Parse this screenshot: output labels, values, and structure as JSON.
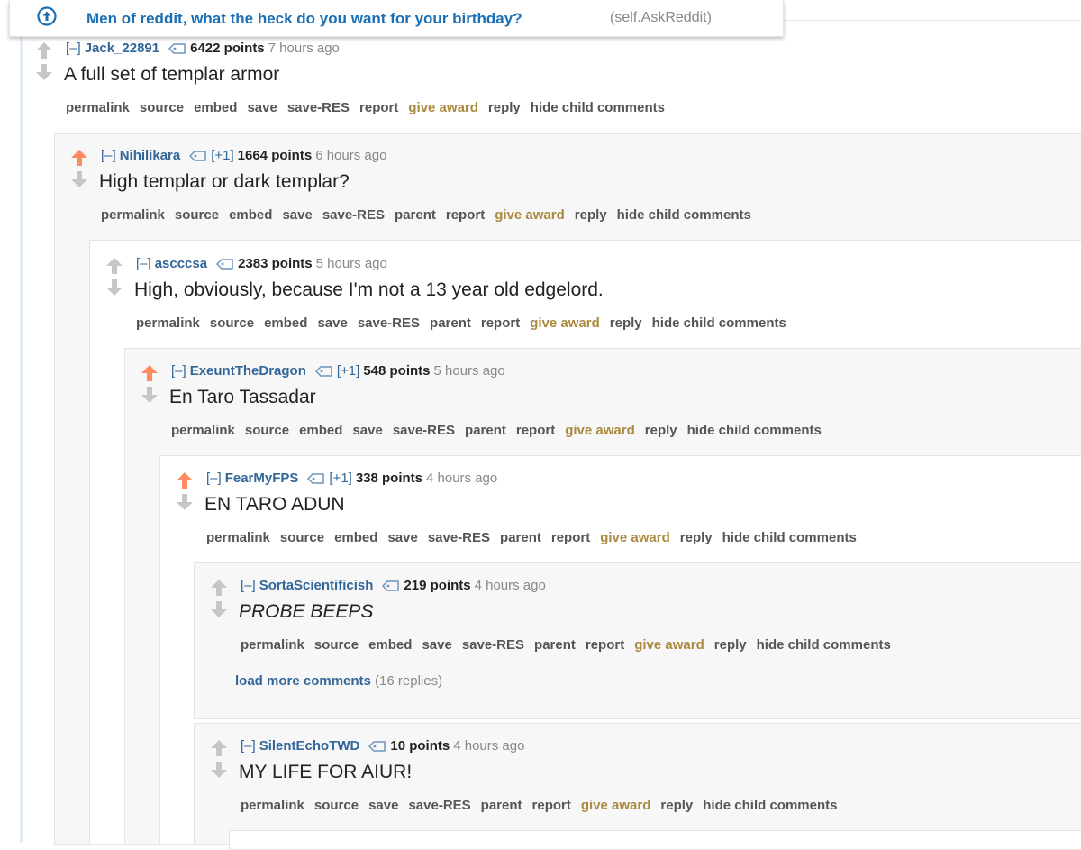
{
  "header": {
    "title": "Men of reddit, what the heck do you want for your birthday?",
    "domain": "(self.AskReddit)"
  },
  "comments": [
    {
      "author": "Jack_22891",
      "flair": "",
      "score": "6422 points",
      "time": "7 hours ago",
      "body": "A full set of templar armor",
      "buttons": [
        "permalink",
        "source",
        "embed",
        "save",
        "save-RES",
        "report",
        "give award",
        "reply",
        "hide child comments"
      ],
      "voted": false
    },
    {
      "author": "Nihilikara",
      "flair": "[+1]",
      "score": "1664 points",
      "time": "6 hours ago",
      "body": "High templar or dark templar?",
      "buttons": [
        "permalink",
        "source",
        "embed",
        "save",
        "save-RES",
        "parent",
        "report",
        "give award",
        "reply",
        "hide child comments"
      ],
      "voted": true
    },
    {
      "author": "ascccsa",
      "flair": "",
      "score": "2383 points",
      "time": "5 hours ago",
      "body": "High, obviously, because I'm not a 13 year old edgelord.",
      "buttons": [
        "permalink",
        "source",
        "embed",
        "save",
        "save-RES",
        "parent",
        "report",
        "give award",
        "reply",
        "hide child comments"
      ],
      "voted": false
    },
    {
      "author": "ExeuntTheDragon",
      "flair": "[+1]",
      "score": "548 points",
      "time": "5 hours ago",
      "body": "En Taro Tassadar",
      "buttons": [
        "permalink",
        "source",
        "embed",
        "save",
        "save-RES",
        "parent",
        "report",
        "give award",
        "reply",
        "hide child comments"
      ],
      "voted": true
    },
    {
      "author": "FearMyFPS",
      "flair": "[+1]",
      "score": "338 points",
      "time": "4 hours ago",
      "body": "EN TARO ADUN",
      "buttons": [
        "permalink",
        "source",
        "embed",
        "save",
        "save-RES",
        "parent",
        "report",
        "give award",
        "reply",
        "hide child comments"
      ],
      "voted": true
    },
    {
      "author": "SortaScientificish",
      "flair": "",
      "score": "219 points",
      "time": "4 hours ago",
      "body": "PROBE BEEPS",
      "buttons": [
        "permalink",
        "source",
        "embed",
        "save",
        "save-RES",
        "parent",
        "report",
        "give award",
        "reply",
        "hide child comments"
      ],
      "voted": false,
      "load_more": "load more comments",
      "load_more_count": "(16 replies)"
    },
    {
      "author": "SilentEchoTWD",
      "flair": "",
      "score": "10 points",
      "time": "4 hours ago",
      "body": "MY LIFE FOR AIUR!",
      "buttons": [
        "permalink",
        "source",
        "save",
        "save-RES",
        "parent",
        "report",
        "give award",
        "reply",
        "hide child comments"
      ],
      "voted": false
    }
  ],
  "expand_label": "[–]",
  "colors": {
    "link": "#336699",
    "award": "#aa8a3e",
    "upvoted": "#ff8b60",
    "arrow": "#c6c6c6"
  },
  "icons": {
    "upvote": "up-arrow-icon",
    "downvote": "down-arrow-icon",
    "tag": "tag-icon",
    "post": "up-circle-icon"
  }
}
